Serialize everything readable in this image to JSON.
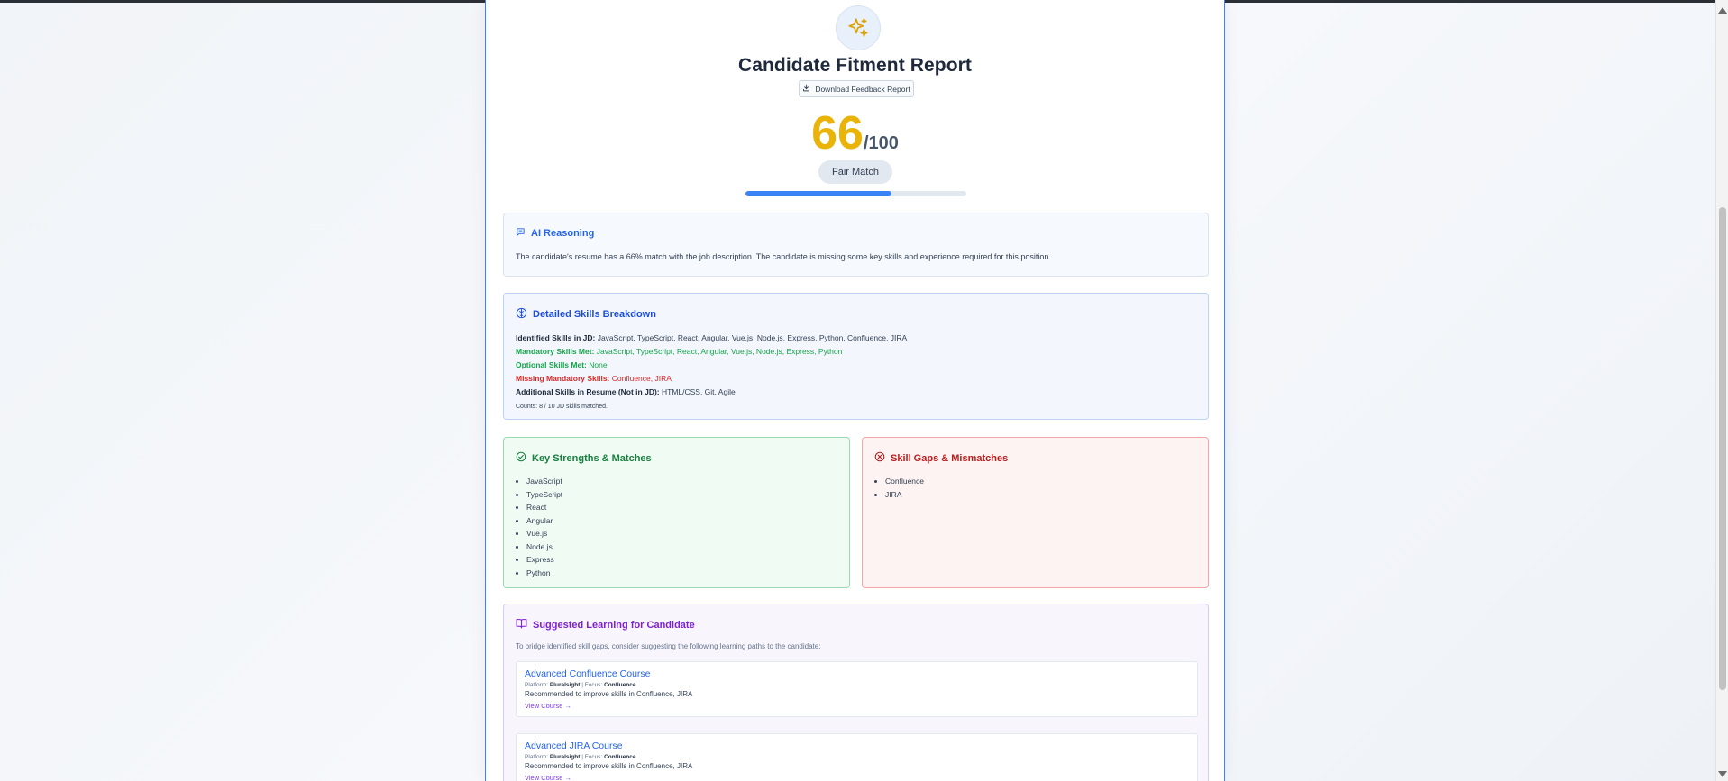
{
  "report": {
    "title": "Candidate Fitment Report",
    "download_label": "Download Feedback Report",
    "score": "66",
    "score_max": "/100",
    "score_fraction": 0.66,
    "match_label": "Fair Match",
    "score_color": "#eab308"
  },
  "reasoning": {
    "heading": "AI Reasoning",
    "text": "The candidate's resume has a 66% match with the job description. The candidate is missing some key skills and experience required for this position."
  },
  "breakdown": {
    "heading": "Detailed Skills Breakdown",
    "identified_label": "Identified Skills in JD:",
    "identified_value": " JavaScript, TypeScript, React, Angular, Vue.js, Node.js, Express, Python, Confluence, JIRA",
    "mandatory_label": "Mandatory Skills Met:",
    "mandatory_value": " JavaScript, TypeScript, React, Angular, Vue.js, Node.js, Express, Python",
    "optional_label": "Optional Skills Met:",
    "optional_value": " None",
    "missing_label": "Missing Mandatory Skills:",
    "missing_value": " Confluence, JIRA",
    "additional_label": "Additional Skills in Resume (Not in JD):",
    "additional_value": " HTML/CSS, Git, Agile",
    "counts": "Counts: 8 / 10 JD skills matched."
  },
  "strengths": {
    "heading": "Key Strengths & Matches",
    "items": [
      "JavaScript",
      "TypeScript",
      "React",
      "Angular",
      "Vue.js",
      "Node.js",
      "Express",
      "Python"
    ]
  },
  "gaps": {
    "heading": "Skill Gaps & Mismatches",
    "items": [
      "Confluence",
      "JIRA"
    ]
  },
  "learning": {
    "heading": "Suggested Learning for Candidate",
    "intro": "To bridge identified skill gaps, consider suggesting the following learning paths to the candidate:",
    "courses": [
      {
        "title": "Advanced Confluence Course",
        "platform_label": "Platform:",
        "platform": "Pluralsight",
        "focus_label": "| Focus:",
        "focus": "Confluence",
        "desc": "Recommended to improve skills in Confluence, JIRA",
        "link": "View Course →"
      },
      {
        "title": "Advanced JIRA Course",
        "platform_label": "Platform:",
        "platform": "Pluralsight",
        "focus_label": "| Focus:",
        "focus": "Confluence",
        "desc": "Recommended to improve skills in Confluence, JIRA",
        "link": "View Course →"
      }
    ]
  }
}
